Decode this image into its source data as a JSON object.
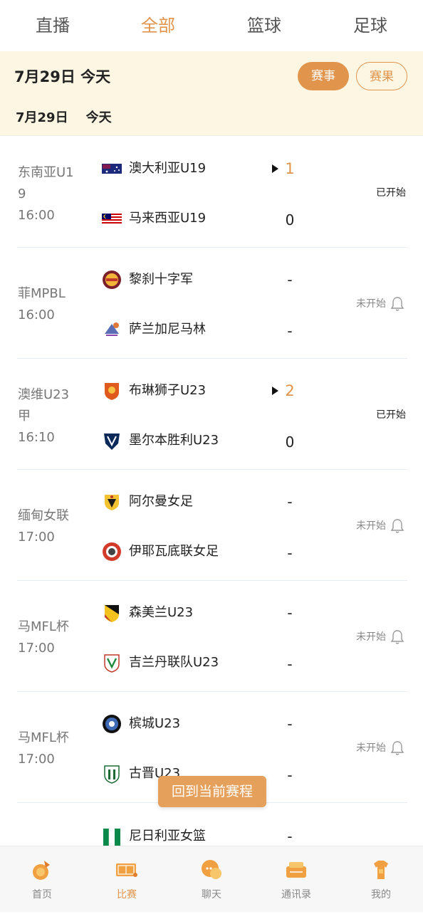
{
  "tabs": [
    {
      "label": "直播",
      "active": false
    },
    {
      "label": "全部",
      "active": true
    },
    {
      "label": "篮球",
      "active": false
    },
    {
      "label": "足球",
      "active": false
    }
  ],
  "date_bar": {
    "date": "7月29日  今天",
    "events_label": "赛事",
    "results_label": "赛果"
  },
  "sub_header": {
    "date": "7月29日    今天"
  },
  "matches": [
    {
      "league": "东南亚U19",
      "league_l1": "东南亚U1",
      "league_l2": "9",
      "time": "16:00",
      "home": "澳大利亚U19",
      "away": "马来西亚U19",
      "home_score": "1",
      "away_score": "0",
      "status": "已开始"
    },
    {
      "league": "菲MPBL",
      "league_l1": "菲MPBL",
      "time": "16:00",
      "home": "黎刹十字军",
      "away": "萨兰加尼马林",
      "home_score": "-",
      "away_score": "-",
      "status": "未开始"
    },
    {
      "league": "澳维U23甲",
      "league_l1": "澳维U23",
      "league_l2": "甲",
      "time": "16:10",
      "home": "布琳狮子U23",
      "away": "墨尔本胜利U23",
      "home_score": "2",
      "away_score": "0",
      "status": "已开始"
    },
    {
      "league": "缅甸女联",
      "league_l1": "缅甸女联",
      "time": "17:00",
      "home": "阿尔曼女足",
      "away": "伊耶瓦底联女足",
      "home_score": "-",
      "away_score": "-",
      "status": "未开始"
    },
    {
      "league": "马MFL杯",
      "league_l1": "马MFL杯",
      "time": "17:00",
      "home": "森美兰U23",
      "away": "吉兰丹联队U23",
      "home_score": "-",
      "away_score": "-",
      "status": "未开始"
    },
    {
      "league": "马MFL杯",
      "league_l1": "马MFL杯",
      "time": "17:00",
      "home": "槟城U23",
      "away": "古晋U23",
      "home_score": "-",
      "away_score": "-",
      "status": "未开始"
    },
    {
      "home": "尼日利亚女篮",
      "home_score": "-"
    }
  ],
  "back_button": "回到当前赛程",
  "bottom_nav": [
    {
      "label": "首页",
      "icon": "home-icon"
    },
    {
      "label": "比赛",
      "icon": "match-icon",
      "active": true
    },
    {
      "label": "聊天",
      "icon": "chat-icon"
    },
    {
      "label": "通讯录",
      "icon": "contacts-icon"
    },
    {
      "label": "我的",
      "icon": "profile-icon"
    }
  ],
  "colors": {
    "accent": "#e0944c",
    "bar_bg": "#fdf6e3"
  }
}
